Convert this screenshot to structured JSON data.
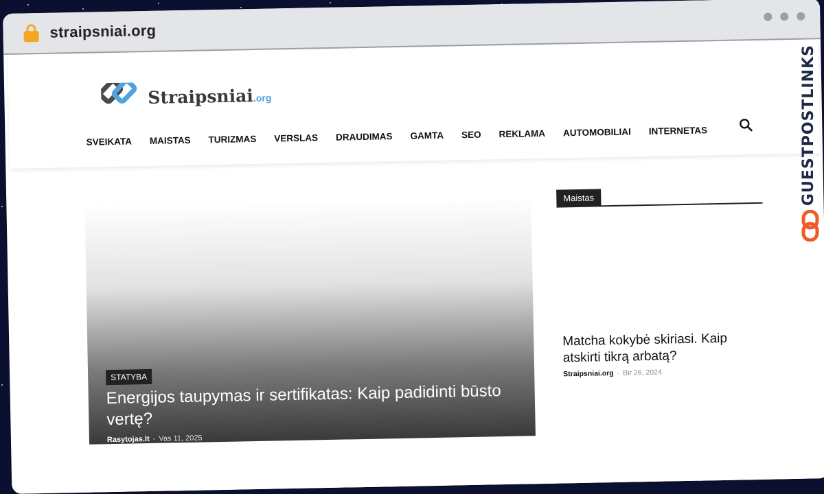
{
  "browser": {
    "url": "straipsniai.org"
  },
  "site": {
    "logo_name": "Straipsniai",
    "logo_suffix": ".org"
  },
  "nav": {
    "items": [
      "SVEIKATA",
      "MAISTAS",
      "TURIZMAS",
      "VERSLAS",
      "DRAUDIMAS",
      "GAMTA",
      "SEO",
      "REKLAMA",
      "AUTOMOBILIAI",
      "INTERNETAS"
    ]
  },
  "hero": {
    "category": "STATYBA",
    "title": "Energijos taupymas ir sertifikatas: Kaip padidinti būsto vertę?",
    "author": "Rasytojas.lt",
    "separator": "-",
    "date": "Vas 11, 2025"
  },
  "sidebar": {
    "section_label": "Maistas",
    "article_title": "Matcha kokybė skiriasi. Kaip atskirti tikrą arbatą?",
    "author": "Straipsniai.org",
    "separator": "-",
    "date": "Bir 26, 2024"
  },
  "watermark": {
    "text": "GUESTPOSTLINKS"
  },
  "colors": {
    "accent_blue": "#4fa3e0",
    "lock_orange": "#f5a623",
    "watermark_orange": "#f05a28",
    "dark": "#222222"
  }
}
